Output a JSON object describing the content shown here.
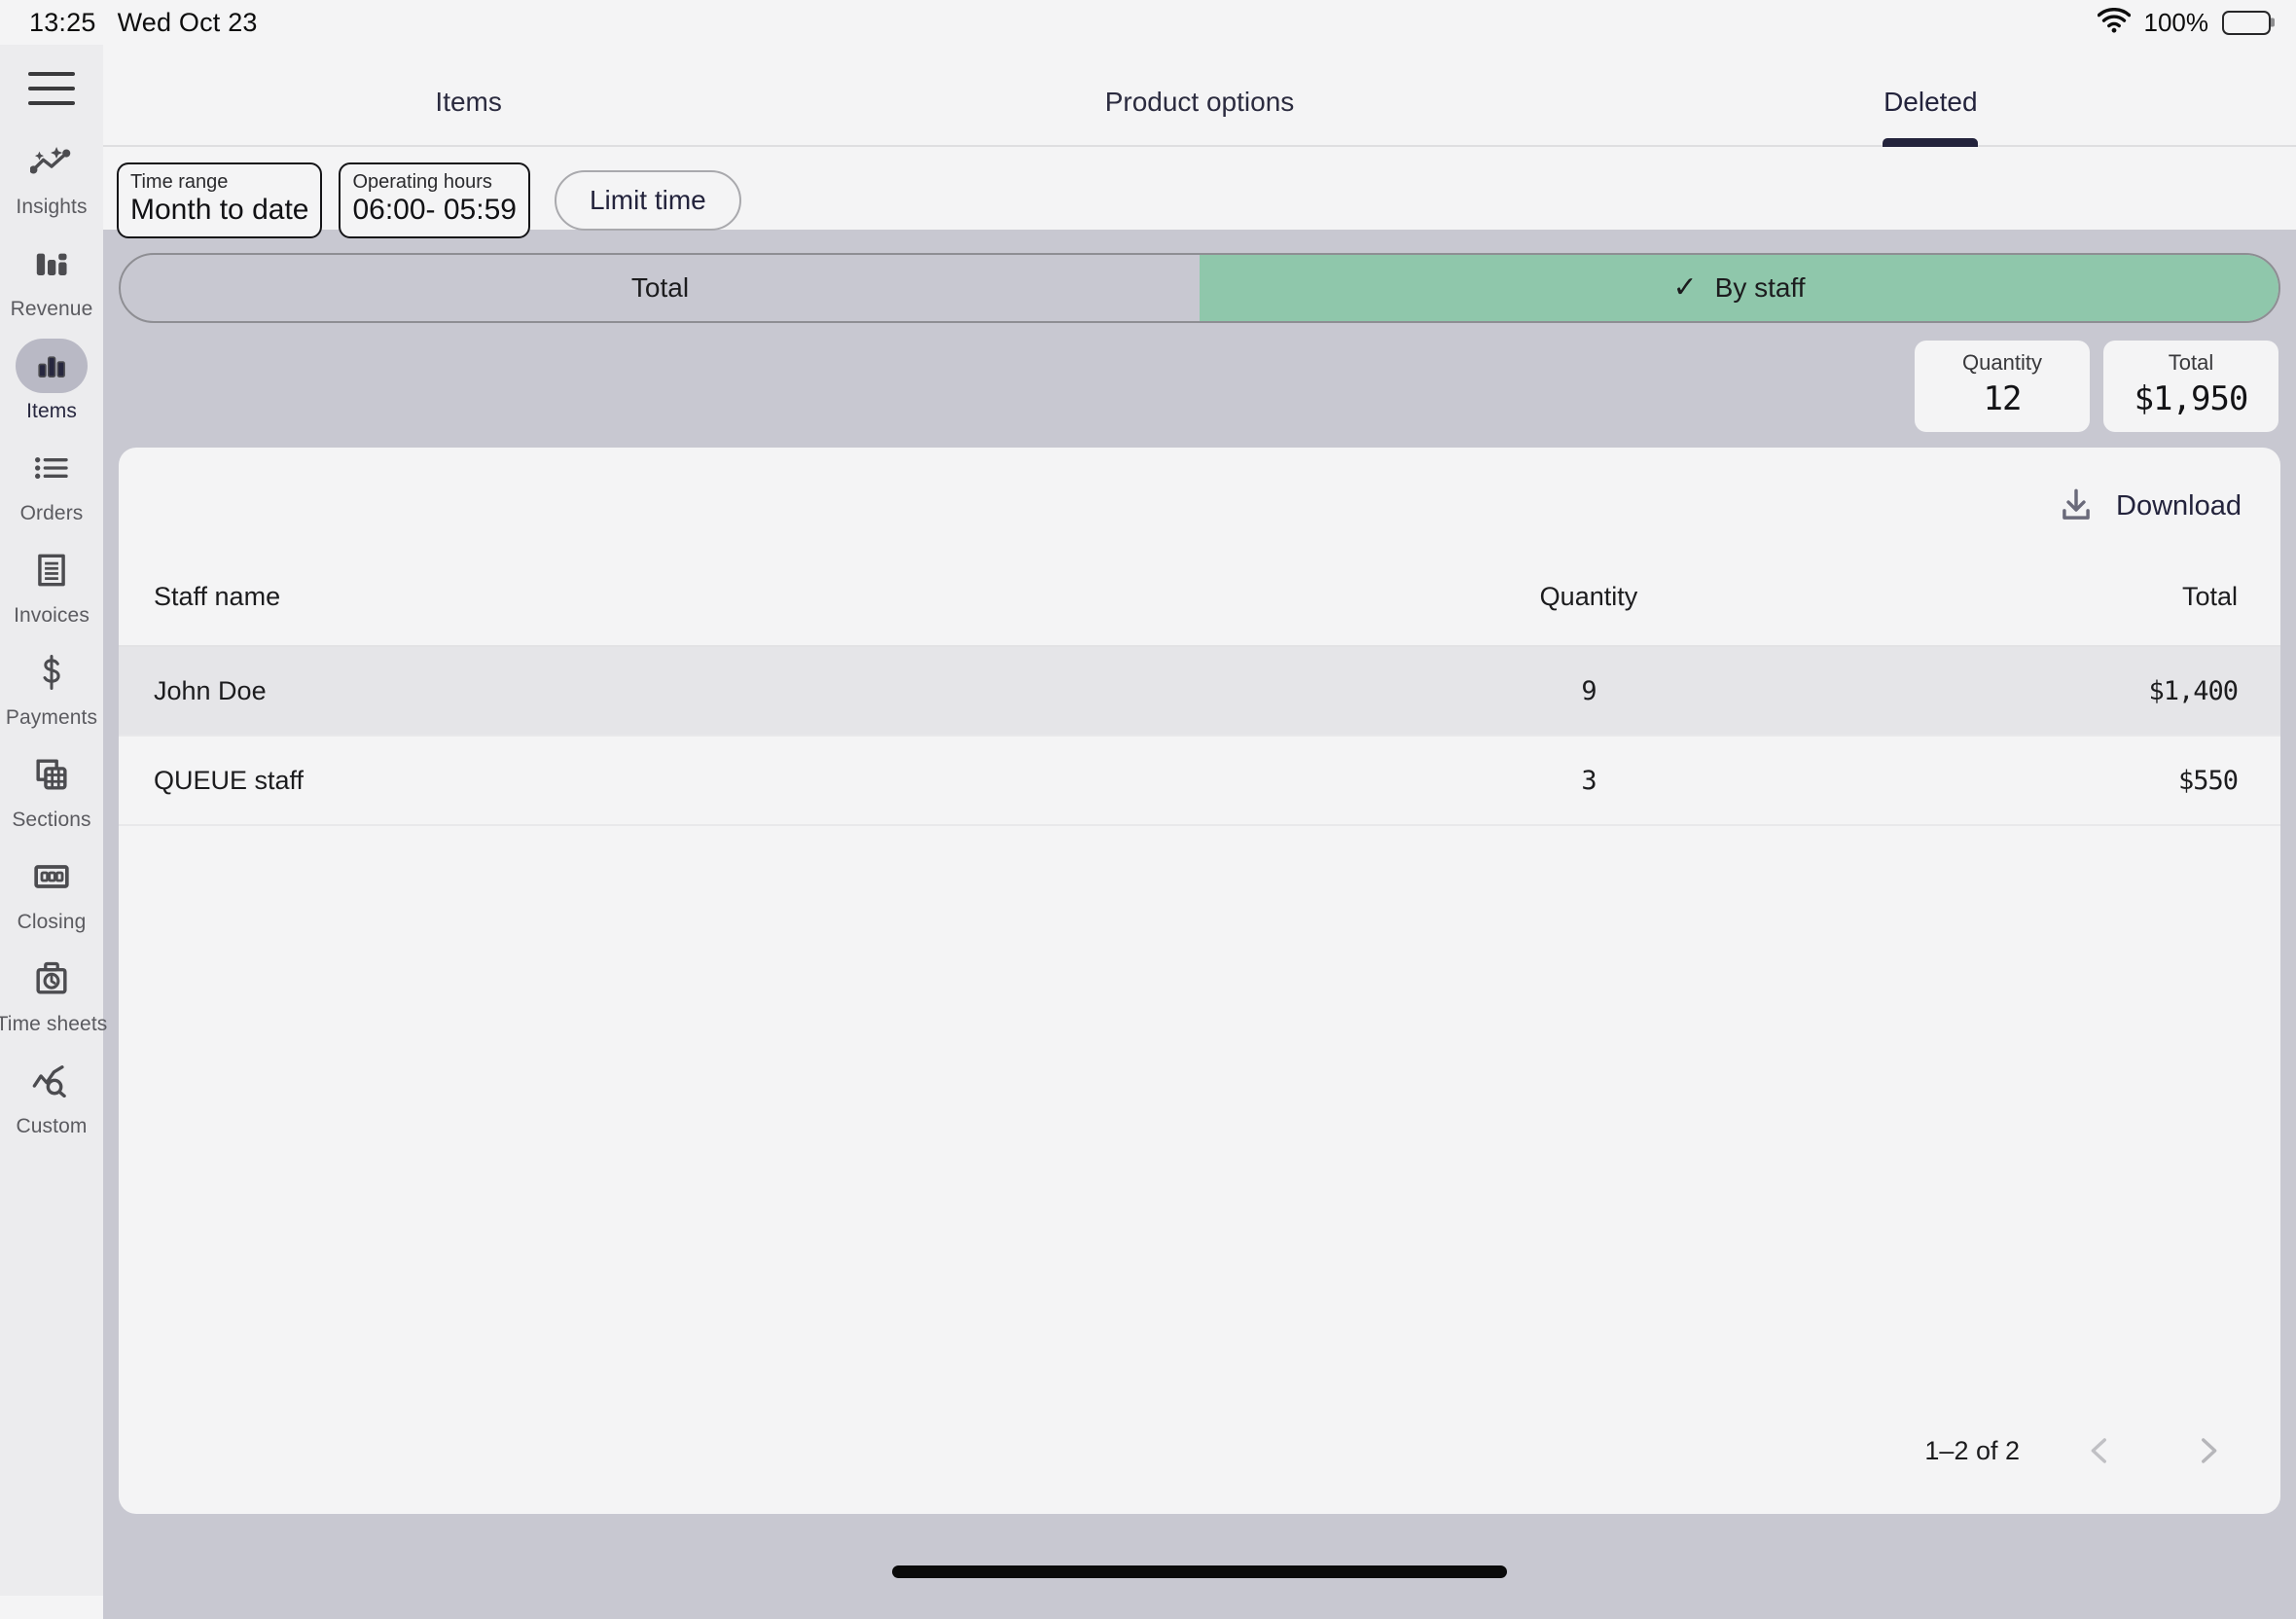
{
  "status_bar": {
    "time": "13:25",
    "date": "Wed Oct 23",
    "battery_percent": "100%",
    "wifi_icon": "wifi-icon",
    "battery_icon": "battery-full-icon"
  },
  "sidebar": {
    "menu_icon": "hamburger-menu-icon",
    "items": [
      {
        "label": "Insights",
        "icon": "insights-sparkline-icon",
        "active": false
      },
      {
        "label": "Revenue",
        "icon": "bar-chart-icon",
        "active": false
      },
      {
        "label": "Items",
        "icon": "bar-chart-solid-icon",
        "active": true
      },
      {
        "label": "Orders",
        "icon": "list-icon",
        "active": false
      },
      {
        "label": "Invoices",
        "icon": "receipt-icon",
        "active": false
      },
      {
        "label": "Payments",
        "icon": "dollar-sign-icon",
        "active": false
      },
      {
        "label": "Sections",
        "icon": "table-copy-icon",
        "active": false
      },
      {
        "label": "Closing",
        "icon": "cash-drawer-icon",
        "active": false
      },
      {
        "label": "Time sheets",
        "icon": "time-clock-icon",
        "active": false
      },
      {
        "label": "Custom",
        "icon": "chart-search-icon",
        "active": false
      }
    ]
  },
  "tabs": [
    {
      "label": "Items",
      "active": false
    },
    {
      "label": "Product options",
      "active": false
    },
    {
      "label": "Deleted",
      "active": true
    }
  ],
  "filters": {
    "time_range": {
      "label": "Time range",
      "value": "Month to date"
    },
    "operating_hours": {
      "label": "Operating hours",
      "value": "06:00- 05:59"
    },
    "limit_time_button": "Limit time"
  },
  "segmented": {
    "options": [
      {
        "label": "Total",
        "active": false
      },
      {
        "label": "By staff",
        "active": true
      }
    ],
    "check_icon": "check-icon",
    "active_color": "#8fc7ab",
    "inactive_color": "#c8c8d1"
  },
  "stats": [
    {
      "label": "Quantity",
      "value": "12"
    },
    {
      "label": "Total",
      "value": "$1,950"
    }
  ],
  "card": {
    "download": {
      "label": "Download",
      "icon": "download-icon"
    },
    "table": {
      "columns": [
        "Staff name",
        "Quantity",
        "Total"
      ],
      "rows": [
        {
          "staff_name": "John Doe",
          "quantity": "9",
          "total": "$1,400"
        },
        {
          "staff_name": "QUEUE staff",
          "quantity": "3",
          "total": "$550"
        }
      ]
    },
    "pagination": {
      "info": "1–2 of 2",
      "prev_icon": "chevron-left-icon",
      "next_icon": "chevron-right-icon"
    }
  },
  "home_indicator": "home-indicator-bar"
}
